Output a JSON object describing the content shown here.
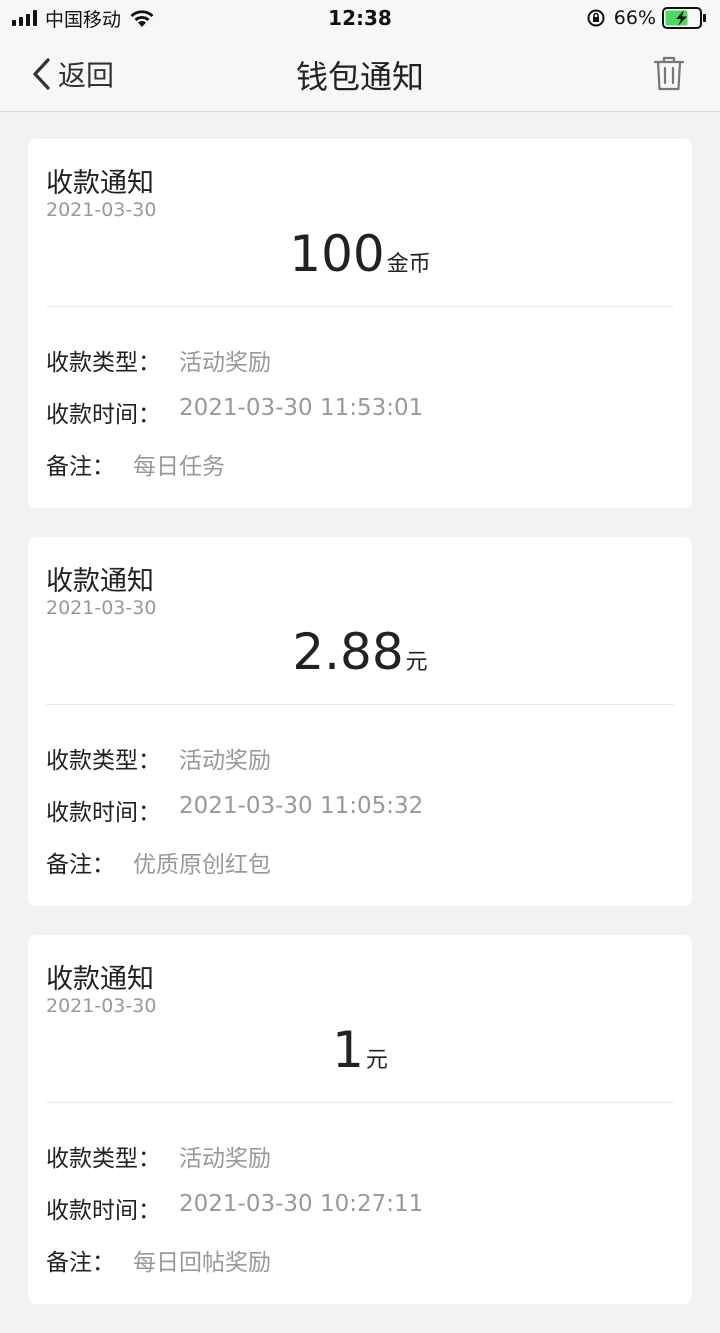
{
  "status_bar": {
    "carrier": "中国移动",
    "time": "12:38",
    "battery_percent": "66%"
  },
  "nav": {
    "back_label": "返回",
    "title": "钱包通知"
  },
  "labels": {
    "type": "收款类型：",
    "time": "收款时间：",
    "note": "备注："
  },
  "cards": [
    {
      "title": "收款通知",
      "date": "2021-03-30",
      "amount": "100",
      "unit": "金币",
      "type": "活动奖励",
      "time": "2021-03-30 11:53:01",
      "note": "每日任务"
    },
    {
      "title": "收款通知",
      "date": "2021-03-30",
      "amount": "2.88",
      "unit": "元",
      "type": "活动奖励",
      "time": "2021-03-30 11:05:32",
      "note": "优质原创红包"
    },
    {
      "title": "收款通知",
      "date": "2021-03-30",
      "amount": "1",
      "unit": "元",
      "type": "活动奖励",
      "time": "2021-03-30 10:27:11",
      "note": "每日回帖奖励"
    }
  ],
  "colors": {
    "background": "#f2f2f2",
    "card": "#ffffff",
    "muted_text": "#999999",
    "battery_fill": "#4cd964"
  }
}
